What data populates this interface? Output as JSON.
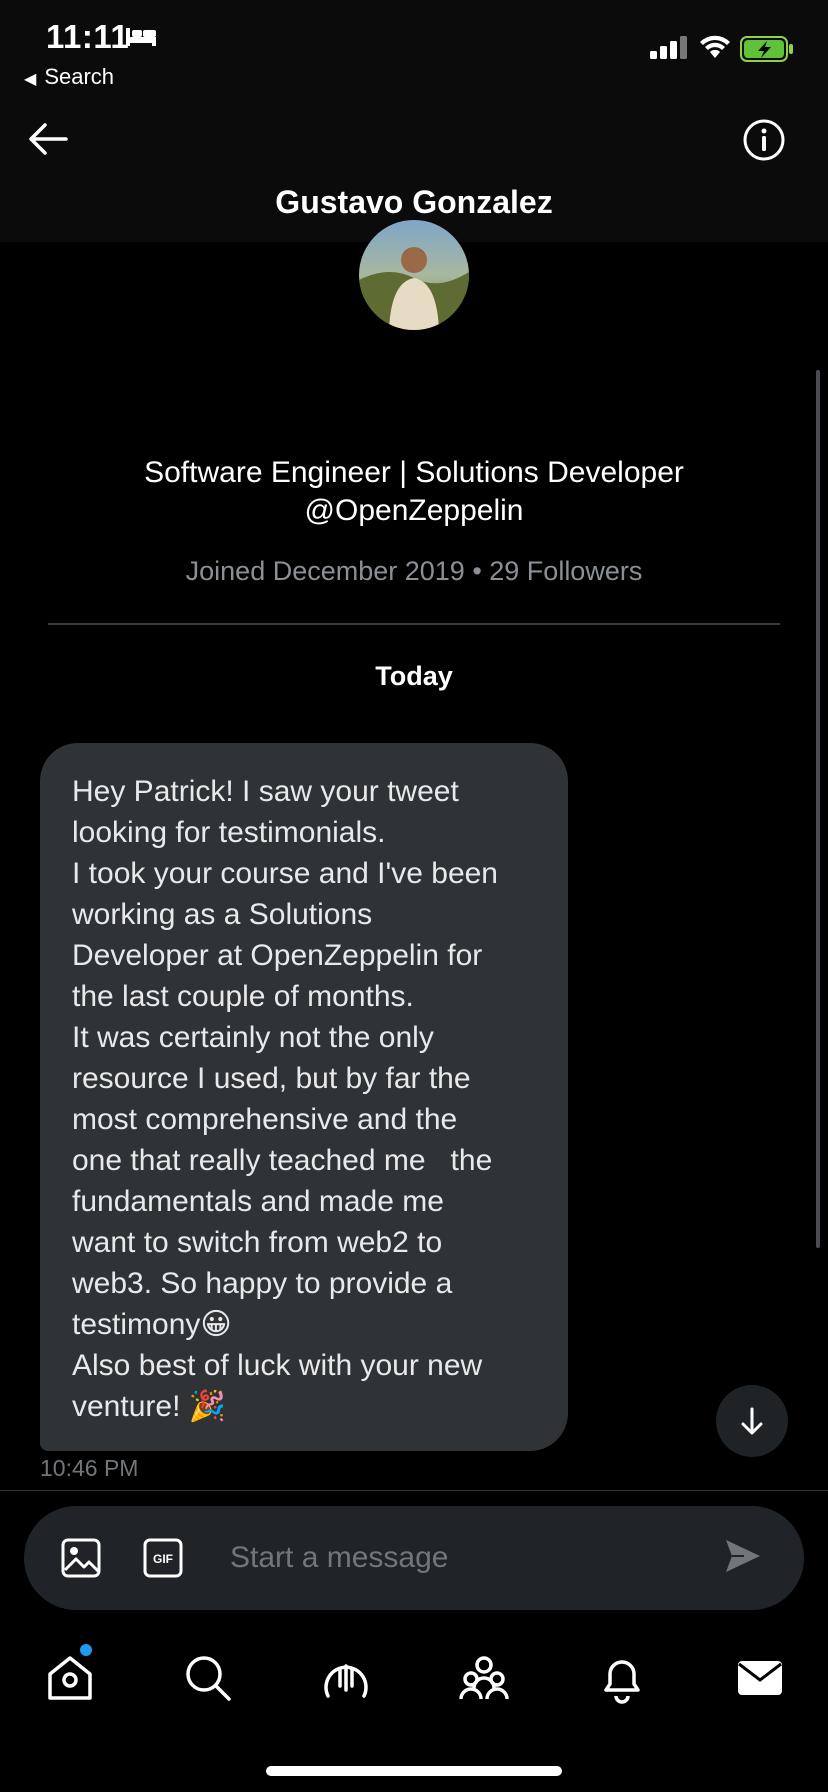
{
  "status_bar": {
    "time": "11:11",
    "back_label": "Search"
  },
  "header": {
    "name": "Gustavo Gonzalez"
  },
  "profile": {
    "bio_line1": "Software Engineer | Solutions Developer",
    "bio_line2": "@OpenZeppelin",
    "meta": "Joined December 2019 • 29 Followers"
  },
  "conversation": {
    "day_label": "Today",
    "message": {
      "lines": [
        "Hey Patrick! I saw your tweet",
        "looking for testimonials.",
        "I took your course and I've been",
        "working as a Solutions",
        "Developer at OpenZeppelin for",
        "the last couple of months.",
        "It was certainly not the only",
        "resource I used, but by far the",
        "most comprehensive and the",
        "one that really teached me   the",
        "fundamentals and made me",
        "want to switch from web2 to",
        "web3. So happy to provide a",
        "testimony😀",
        "Also best of luck with your new",
        "venture! 🎉"
      ],
      "timestamp": "10:46 PM"
    }
  },
  "composer": {
    "placeholder": "Start a message"
  },
  "colors": {
    "accent": "#1d9bf0",
    "bubble": "#2f3336",
    "muted": "#71767b"
  },
  "tabs": [
    "home-icon",
    "search-icon",
    "spaces-icon",
    "communities-icon",
    "notifications-icon",
    "messages-icon"
  ]
}
